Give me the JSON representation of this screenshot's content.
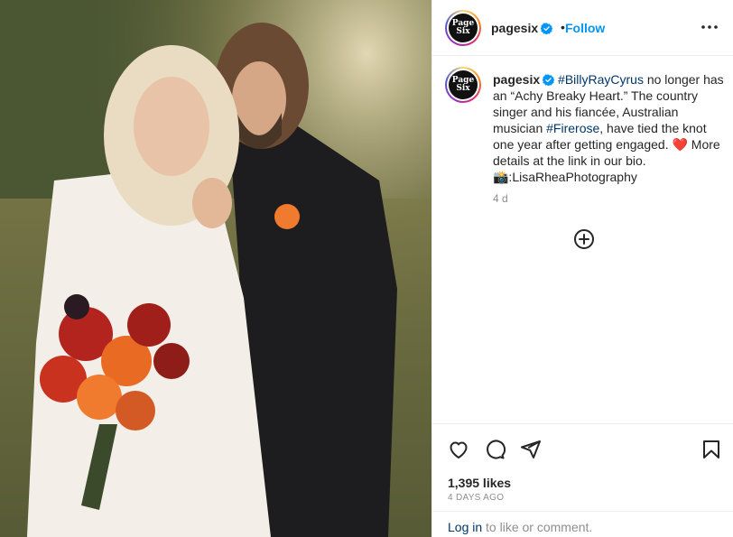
{
  "post": {
    "username": "pagesix",
    "avatar_text_top": "Page",
    "avatar_text_bottom": "Six",
    "follow_label": "Follow",
    "separator": "•",
    "photo_alt": "Wedding photo of Billy Ray Cyrus and Firerose"
  },
  "caption": {
    "username": "pagesix",
    "tag1": "#BillyRayCyrus",
    "text1": " no longer has an “Achy Breaky Heart.” The country singer and his fiancée, Australian musician ",
    "tag2": "#Firerose",
    "text2": ", have tied the knot one year after getting engaged. ❤️ More details at the link in our bio. 📸:LisaRheaPhotography",
    "time": "4 d"
  },
  "actions": {
    "likes": "1,395 likes",
    "date": "4 DAYS AGO",
    "login_link": "Log in",
    "login_text": " to like or comment."
  },
  "icons": {
    "more": "more-horizontal-icon",
    "verified": "verified-badge-icon",
    "load_more": "plus-circle-icon",
    "like": "heart-icon",
    "comment": "comment-icon",
    "share": "share-icon",
    "save": "bookmark-icon"
  },
  "colors": {
    "accent": "#0095f6",
    "link": "#00376b",
    "muted": "#8e8e8e",
    "verified": "#0095f6"
  }
}
